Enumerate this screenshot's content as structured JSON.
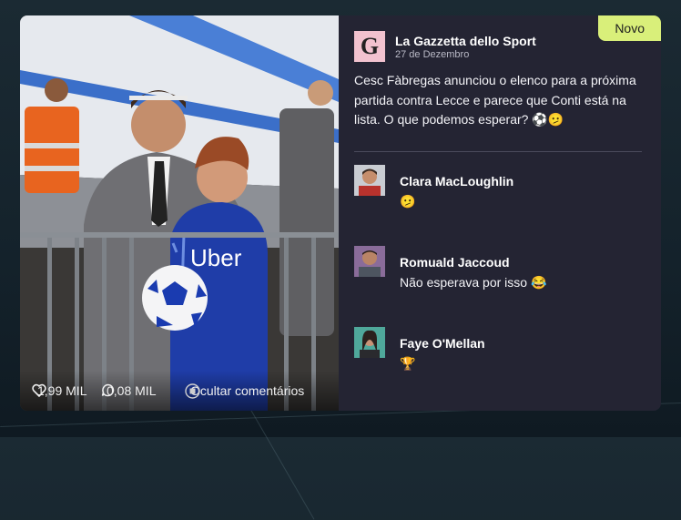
{
  "badge": "Novo",
  "publisher": {
    "logo_letter": "G",
    "name": "La Gazzetta dello Sport",
    "date": "27 de Dezembro"
  },
  "post": {
    "text": "Cesc Fàbregas anunciou o elenco para a próxima partida contra Lecce e parece que Conti está na lista. O que podemos esperar? ⚽🫤",
    "likes": "1,99 MIL",
    "comments": "0,08 MIL",
    "hide_comments_label": "Ocultar comentários",
    "shirt_sponsor": "Uber"
  },
  "comments": [
    {
      "name": "Clara MacLoughlin",
      "text": "🫤"
    },
    {
      "name": "Romuald Jaccoud",
      "text": "Não esperava por isso 😂"
    },
    {
      "name": "Faye O'Mellan",
      "text": "🏆"
    }
  ],
  "colors": {
    "badge": "#d9ef7a",
    "card": "#242433",
    "publisher_logo": "#f2c2cf"
  }
}
